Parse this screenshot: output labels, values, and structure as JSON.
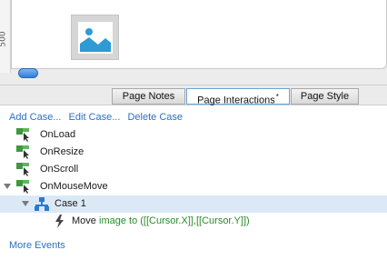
{
  "canvas": {
    "ruler_label": "500"
  },
  "tabs": [
    {
      "label": "Page Notes",
      "dirty": ""
    },
    {
      "label": "Page Interactions",
      "dirty": "*"
    },
    {
      "label": "Page Style",
      "dirty": ""
    }
  ],
  "panel": {
    "actions": {
      "add_case": "Add Case...",
      "edit_case": "Edit Case...",
      "delete_case": "Delete Case"
    },
    "events": [
      {
        "label": "OnLoad"
      },
      {
        "label": "OnResize"
      },
      {
        "label": "OnScroll"
      },
      {
        "label": "OnMouseMove"
      }
    ],
    "case": {
      "label": "Case 1"
    },
    "action": {
      "verb": "Move",
      "detail": "image to ([[Cursor.X]],[[Cursor.Y]])"
    },
    "more_events": "More Events"
  },
  "colors": {
    "link": "#2a6fc9",
    "action_detail": "#2b8a2b",
    "selected_row": "#dbe9f7"
  }
}
